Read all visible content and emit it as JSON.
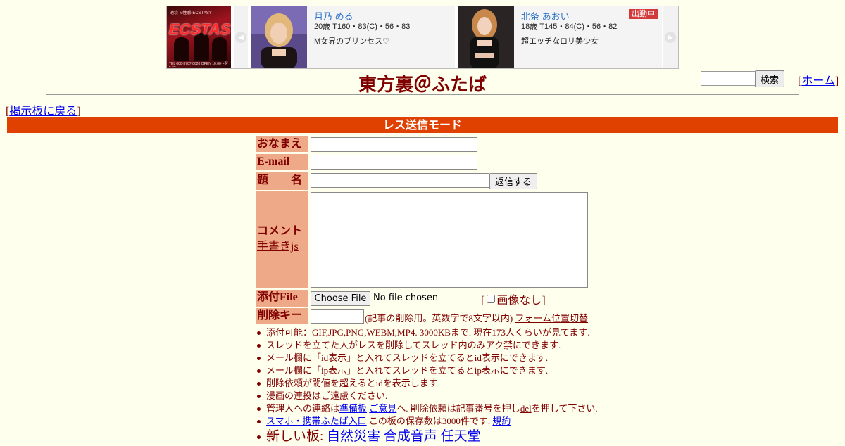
{
  "banner": {
    "logo": {
      "text": "ECSTASY",
      "top_text": "池袋 M性感 ECSTASY",
      "bottom_text": "TEL 080-3707-0620 OPEN 10:00〜翌5:00"
    },
    "cards": [
      {
        "name": "月乃 める",
        "stats": "20歳 T160・83(C)・56・83",
        "catch": "M女界のプリンセス♡",
        "badge": ""
      },
      {
        "name": "北条 あおい",
        "stats": "18歳 T145・84(C)・56・82",
        "catch": "超エッチなロリ美少女",
        "badge": "出勤中"
      }
    ],
    "prev_icon": "chevron-left-icon",
    "next_icon": "chevron-right-icon"
  },
  "header": {
    "title": "東方裏＠ふたば",
    "search_button": "検索",
    "search_value": "",
    "home_link": "ホーム",
    "back_link": "掲示板に戻る",
    "bracket_open": "[",
    "bracket_close": "]"
  },
  "mode_bar": "レス送信モード",
  "form": {
    "name_label": "おなまえ",
    "email_label": "E-mail",
    "subject_label": "題　　名",
    "submit_button": "返信する",
    "comment_label": "コメント",
    "handwrite_link": "手書きjs",
    "file_label": "添付File",
    "choose_file_button": "Choose File",
    "no_file_text": "No file chosen",
    "no_image_label": "画像なし",
    "no_image_checked": false,
    "delkey_label": "削除キー",
    "delkey_note": "(記事の削除用。英数字で8文字以内)",
    "form_position_link": "フォーム位置切替"
  },
  "notes": {
    "n1": "添付可能：GIF,JPG,PNG,WEBM,MP4. 3000KBまで. 現在173人くらいが見てます.",
    "n2": "スレッドを立てた人がレスを削除してスレッド内のみアク禁にできます.",
    "n3": "メール欄に「id表示」と入れてスレッドを立てるとid表示にできます.",
    "n4": "メール欄に「ip表示」と入れてスレッドを立てるとip表示にできます.",
    "n5": "削除依頼が閾値を超えるとidを表示します.",
    "n6": "漫画の連投はご遠慮ください.",
    "n7_pre": "管理人への連絡は",
    "n7_link1": "準備板",
    "n7_link2": "ご意見",
    "n7_mid": "へ. 削除依頼は記事番号を押し",
    "n7_del": "del",
    "n7_post": "を押して下さい.",
    "n8_link": "スマホ・携帯ふたば入口",
    "n8_mid": " この板の保存数は3000件です.",
    "n8_rules": "規約",
    "n9_label": "新しい板:",
    "n9_boards": [
      "自然災害",
      "合成音声",
      "任天堂"
    ]
  }
}
